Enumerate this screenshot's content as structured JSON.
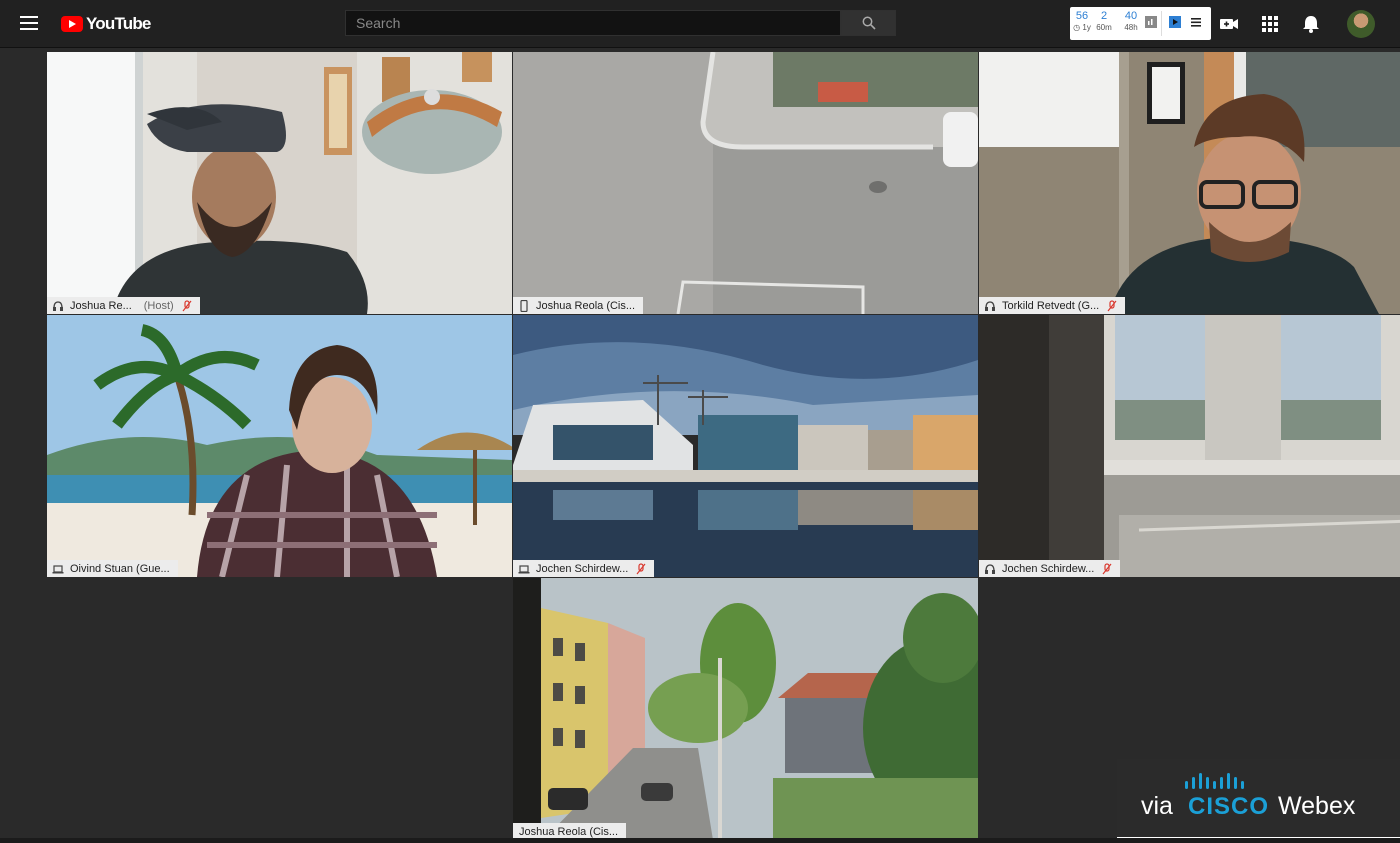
{
  "app": {
    "brand": "YouTube"
  },
  "search": {
    "placeholder": "Search"
  },
  "stats": [
    {
      "value": "56",
      "sub": "1y"
    },
    {
      "value": "2",
      "sub": "60m"
    },
    {
      "value": "40",
      "sub": "48h"
    }
  ],
  "icons": {
    "menu": "hamburger-menu-icon",
    "search": "magnifier-icon",
    "create": "video-camera-plus-icon",
    "apps": "grid-icon",
    "notifications": "bell-icon"
  },
  "participants": [
    {
      "name": "Joshua Re...",
      "role": "(Host)",
      "device": "headset-icon",
      "muted": true
    },
    {
      "name": "Joshua Reola (Cis...",
      "role": "",
      "device": "phone-icon",
      "muted": false
    },
    {
      "name": "Torkild Retvedt (G...",
      "role": "",
      "device": "headset-icon",
      "muted": true
    },
    {
      "name": "Oivind Stuan (Gue...",
      "role": "",
      "device": "laptop-icon",
      "muted": false
    },
    {
      "name": "Jochen Schirdew...",
      "role": "",
      "device": "laptop-icon",
      "muted": true
    },
    {
      "name": "Jochen Schirdew...",
      "role": "",
      "device": "headset-icon",
      "muted": true
    },
    {
      "name": "Joshua Reola (Cis...",
      "role": "",
      "device": "",
      "muted": false
    }
  ],
  "overlay": {
    "via": "via",
    "brand": "CISCO",
    "product": "Webex"
  },
  "colors": {
    "topbar": "#212121",
    "background": "#2a2a2a",
    "accent_red": "#ff0000",
    "cisco_blue": "#1ba0d7",
    "stat_blue": "#2d7fd3"
  }
}
